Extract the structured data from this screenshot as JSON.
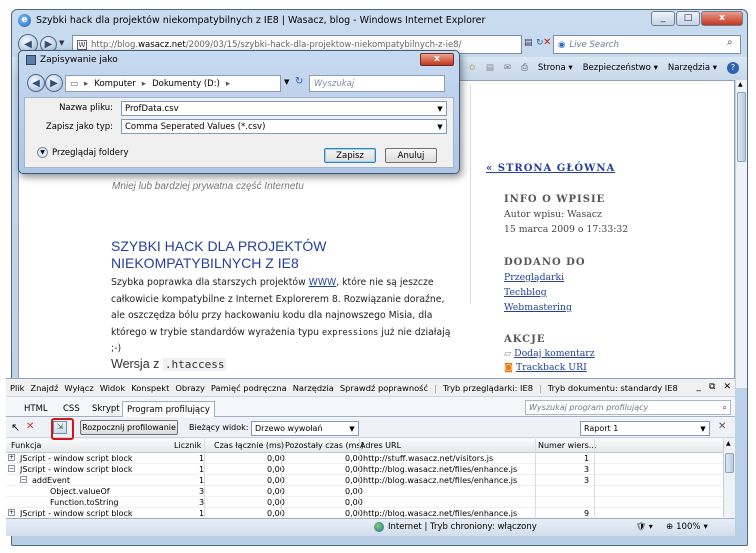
{
  "window": {
    "title": "Szybki hack dla projektów niekompatybilnych z IE8 | Wasacz, blog - Windows Internet Explorer",
    "controls": [
      "_",
      "□",
      "x"
    ]
  },
  "nav": {
    "address_prefix": "http://blog.",
    "address_domain": "wasacz.net",
    "address_rest": "/2009/03/15/szybki-hack-dla-projektow-niekompatybilnych-z-ie8/",
    "search_placeholder": "Live Search"
  },
  "command_bar": {
    "strona": "Strona ▾",
    "bezpieczenstwo": "Bezpieczeństwo ▾",
    "narzedzia": "Narzędzia ▾"
  },
  "blog": {
    "subtitle": "Mniej lub bardziej prywatna część Internetu",
    "post_title": "SZYBKI HACK DLA PROJEKTÓW NIEKOMPATYBILNYCH Z IE8",
    "para_1": "Szybka poprawka dla starszych projektów ",
    "para_link": "WWW",
    "para_2": ", które nie są jeszcze całkowicie kompatybilne z Internet Explorerem 8. Rozwiązanie doraźne, ale oszczędza bólu przy hackowaniu kodu dla najnowszego Misia, dla którego w trybie standardów wyrażenia typu ",
    "para_code": "expressions",
    "para_3": " już nie działają ;-)",
    "h2_text": "Wersja z ",
    "h2_code": ".htaccess"
  },
  "sidebar": {
    "home": "« STRONA GŁÓWNA",
    "info_title": "INFO O WPISIE",
    "author": "Autor wpisu: Wasacz",
    "date": "15 marca 2009 o 17:33:32",
    "added_title": "DODANO DO",
    "cats": [
      "Przeglądarki",
      "Techblog",
      "Webmastering"
    ],
    "actions_title": "AKCJE",
    "actions": [
      "Dodaj komentarz",
      "Trackback URI"
    ]
  },
  "dialog": {
    "title": "Zapisywanie jako",
    "crumb_1": "Komputer",
    "crumb_2": "Dokumenty (D:)",
    "search_placeholder": "Wyszukaj",
    "filename_label": "Nazwa pliku:",
    "filename_value": "ProfData.csv",
    "type_label": "Zapisz jako typ:",
    "type_value": "Comma Seperated Values (*.csv)",
    "browse": "Przeglądaj foldery",
    "save": "Zapisz",
    "cancel": "Anuluj"
  },
  "devtools": {
    "menu": [
      "Plik",
      "Znajdź",
      "Wyłącz",
      "Widok",
      "Konspekt",
      "Obrazy",
      "Pamięć podręczna",
      "Narzędzia",
      "Sprawdź poprawność"
    ],
    "mode_browser": "Tryb przeglądarki: IE8",
    "mode_doc": "Tryb dokumentu: standardy IE8",
    "tabs": [
      "HTML",
      "CSS",
      "Skrypt",
      "Program profilujący"
    ],
    "search_placeholder": "Wyszukaj program profilujący",
    "start_btn": "Rozpocznij profilowanie",
    "view_label": "Bieżący widok:",
    "view_value": "Drzewo wywołań",
    "report_value": "Raport 1",
    "columns": [
      "Funkcja",
      "Licznik",
      "Czas łącznie (ms)",
      "Pozostały czas (ms)",
      "Adres URL",
      "Numer wiers..."
    ],
    "rows": [
      {
        "fn": "JScript - window script block",
        "count": "1",
        "total": "0,00",
        "rest": "0,00",
        "url": "http://stuff.wasacz.net/visitors.js",
        "line": "1",
        "indent": 0,
        "tree": "+"
      },
      {
        "fn": "JScript - window script block",
        "count": "1",
        "total": "0,00",
        "rest": "0,00",
        "url": "http://blog.wasacz.net/files/enhance.js",
        "line": "3",
        "indent": 0,
        "tree": "−"
      },
      {
        "fn": "addEvent",
        "count": "1",
        "total": "0,00",
        "rest": "0,00",
        "url": "http://blog.wasacz.net/files/enhance.js",
        "line": "3",
        "indent": 1,
        "tree": "−"
      },
      {
        "fn": "Object.valueOf",
        "count": "3",
        "total": "0,00",
        "rest": "0,00",
        "url": "",
        "line": "",
        "indent": 2,
        "tree": ""
      },
      {
        "fn": "Function.toString",
        "count": "3",
        "total": "0,00",
        "rest": "0,00",
        "url": "",
        "line": "",
        "indent": 2,
        "tree": ""
      },
      {
        "fn": "JScript - window script block",
        "count": "1",
        "total": "0,00",
        "rest": "0,00",
        "url": "http://blog.wasacz.net/files/enhance.js",
        "line": "9",
        "indent": 0,
        "tree": "+"
      }
    ]
  },
  "status": {
    "zone": "Internet | Tryb chroniony: włączony",
    "zoom": "100%"
  }
}
